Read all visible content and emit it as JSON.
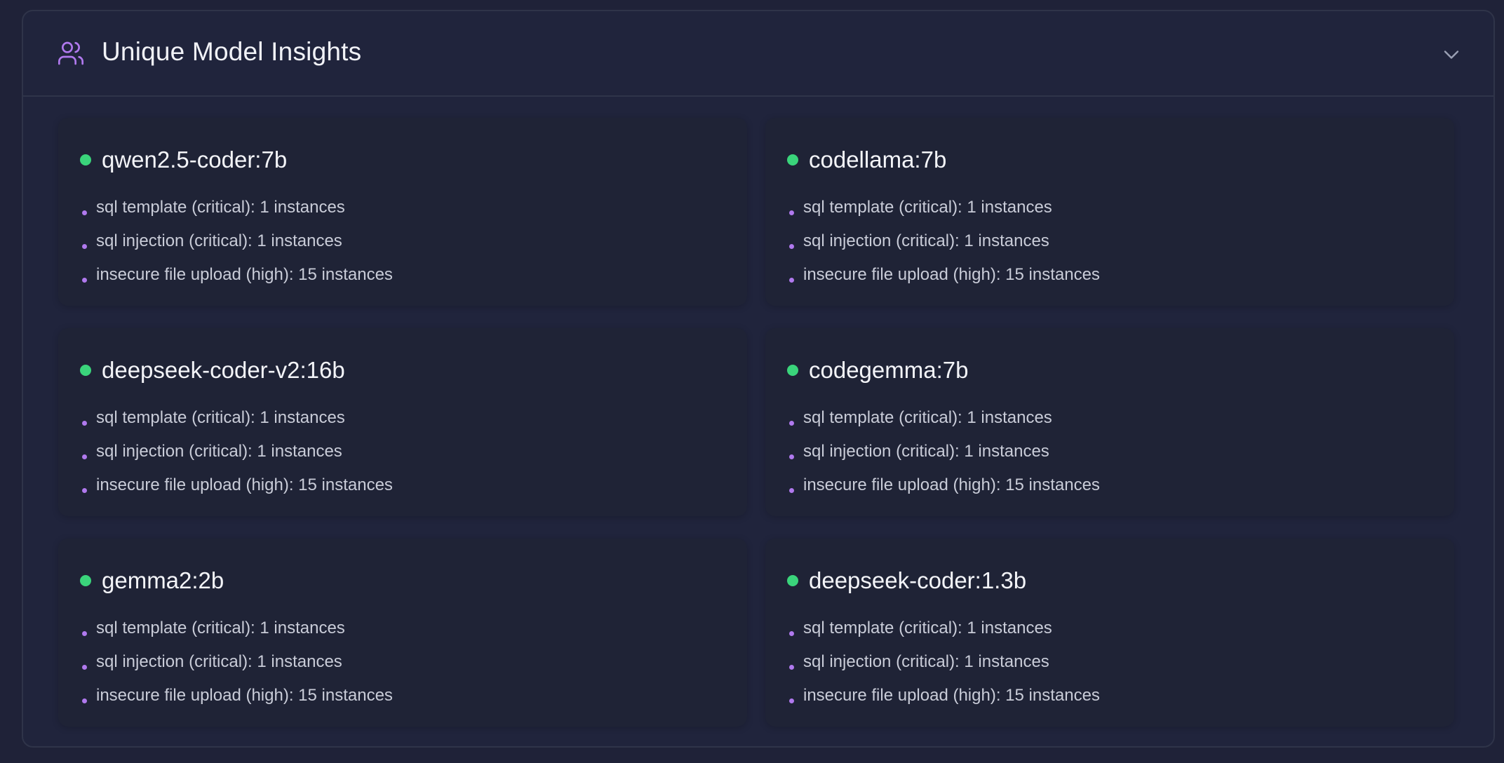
{
  "panel": {
    "title": "Unique Model Insights",
    "icon": "users-icon",
    "collapse_icon": "chevron-down-icon"
  },
  "colors": {
    "accent": "#b079ee",
    "status_active": "#3ad47b"
  },
  "models": [
    {
      "name": "qwen2.5-coder:7b",
      "insights": [
        "sql template (critical): 1 instances",
        "sql injection (critical): 1 instances",
        "insecure file upload (high): 15 instances"
      ]
    },
    {
      "name": "codellama:7b",
      "insights": [
        "sql template (critical): 1 instances",
        "sql injection (critical): 1 instances",
        "insecure file upload (high): 15 instances"
      ]
    },
    {
      "name": "deepseek-coder-v2:16b",
      "insights": [
        "sql template (critical): 1 instances",
        "sql injection (critical): 1 instances",
        "insecure file upload (high): 15 instances"
      ]
    },
    {
      "name": "codegemma:7b",
      "insights": [
        "sql template (critical): 1 instances",
        "sql injection (critical): 1 instances",
        "insecure file upload (high): 15 instances"
      ]
    },
    {
      "name": "gemma2:2b",
      "insights": [
        "sql template (critical): 1 instances",
        "sql injection (critical): 1 instances",
        "insecure file upload (high): 15 instances"
      ]
    },
    {
      "name": "deepseek-coder:1.3b",
      "insights": [
        "sql template (critical): 1 instances",
        "sql injection (critical): 1 instances",
        "insecure file upload (high): 15 instances"
      ]
    }
  ]
}
